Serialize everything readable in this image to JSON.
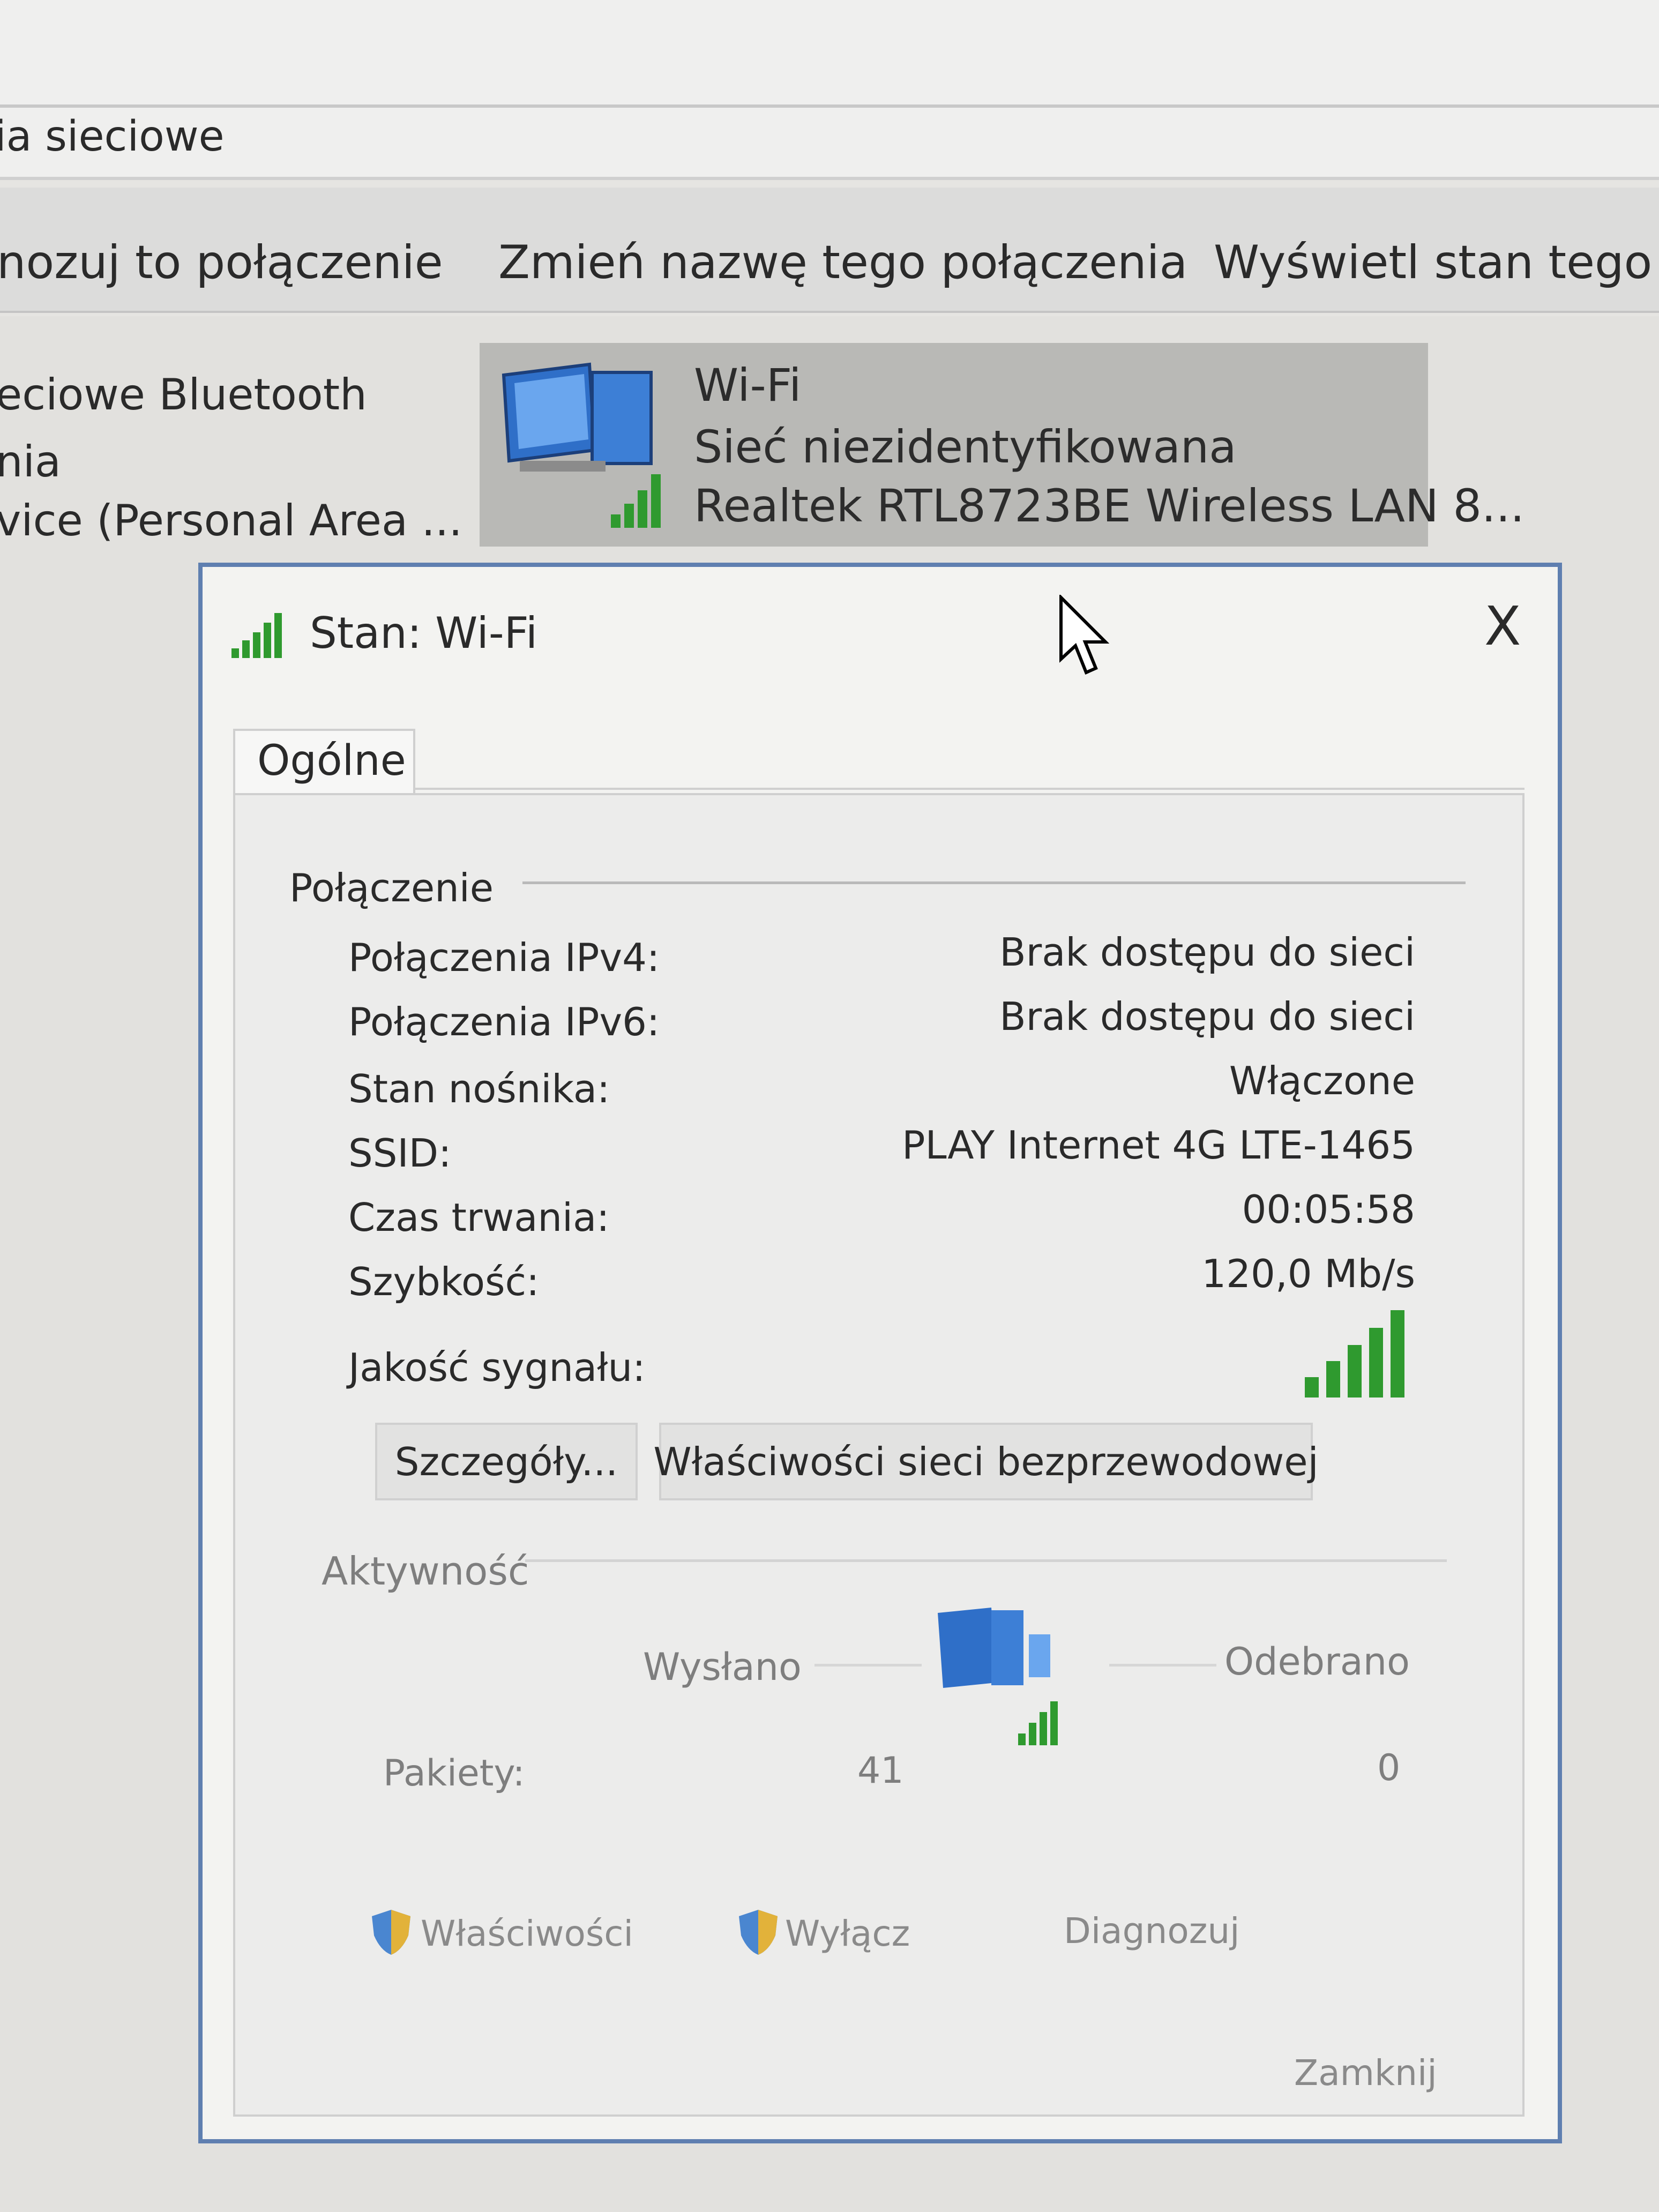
{
  "window": {
    "address": "ia sieciowe",
    "commands": [
      "nozuj to połączenie",
      "Zmień nazwę tego połączenia",
      "Wyświetl stan tego po"
    ]
  },
  "connections": {
    "bluetooth_lines": [
      "eciowe Bluetooth",
      "nia",
      "vice (Personal Area ..."
    ],
    "wifi": {
      "name": "Wi-Fi",
      "status": "Sieć niezidentyfikowana",
      "adapter": "Realtek RTL8723BE Wireless LAN 8..."
    }
  },
  "dialog": {
    "title": "Stan: Wi-Fi",
    "close": "X",
    "tab": "Ogólne",
    "connection_group": "Połączenie",
    "rows": [
      {
        "label": "Połączenia IPv4:",
        "value": "Brak dostępu do sieci"
      },
      {
        "label": "Połączenia IPv6:",
        "value": "Brak dostępu do sieci"
      },
      {
        "label": "Stan nośnika:",
        "value": "Włączone"
      },
      {
        "label": "SSID:",
        "value": "PLAY Internet 4G LTE-1465"
      },
      {
        "label": "Czas trwania:",
        "value": "00:05:58"
      },
      {
        "label": "Szybkość:",
        "value": "120,0 Mb/s"
      }
    ],
    "signal_label": "Jakość sygnału:",
    "signal_bars": 5,
    "details_button": "Szczegóły...",
    "wireless_props_button": "Właściwości sieci bezprzewodowej",
    "activity_group": "Aktywność",
    "sent_label": "Wysłano",
    "received_label": "Odebrano",
    "packets_label": "Pakiety:",
    "packets_sent": "41",
    "packets_received": "0",
    "properties_button": "Właściwości",
    "disable_button": "Wyłącz",
    "diagnose_button": "Diagnozuj",
    "close_button": "Zamknij"
  },
  "colors": {
    "signal_green": "#2f9a2f",
    "dialog_border": "#5f7fb0"
  }
}
